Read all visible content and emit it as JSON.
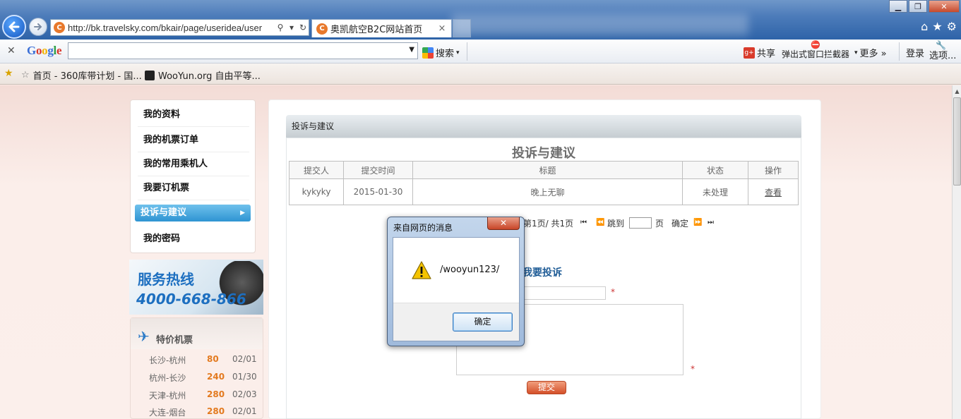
{
  "browser": {
    "address_url": "http://bk.travelsky.com/bkair/page/useridea/user",
    "active_tab_title": "奥凯航空B2C网站首页",
    "google_toolbar": {
      "logo": "Google",
      "search_label": "搜索",
      "share_label": "共享",
      "popup_blocker_label": "弹出式窗口拦截器",
      "more_label": "更多 »",
      "login_label": "登录",
      "options_label": "选项..."
    },
    "favorites": [
      {
        "label": "首页 - 360库带计划 - 国..."
      },
      {
        "label": "WooYun.org  自由平等..."
      }
    ]
  },
  "sidebar": {
    "items": [
      {
        "label": "我的资料"
      },
      {
        "label": "我的机票订单"
      },
      {
        "label": "我的常用乘机人"
      },
      {
        "label": "我要订机票"
      },
      {
        "label": "投诉与建议"
      },
      {
        "label": "我的密码"
      }
    ],
    "hotline": {
      "title": "服务热线",
      "number": "4000-668-866"
    },
    "specials": {
      "title": "特价机票",
      "rows": [
        {
          "route": "长沙-杭州",
          "price": "80",
          "date": "02/01"
        },
        {
          "route": "杭州-长沙",
          "price": "240",
          "date": "01/30"
        },
        {
          "route": "天津-杭州",
          "price": "280",
          "date": "02/03"
        },
        {
          "route": "大连-烟台",
          "price": "280",
          "date": "02/01"
        }
      ]
    }
  },
  "main": {
    "panel_header": "投诉与建议",
    "panel_title": "投诉与建议",
    "table": {
      "headers": [
        "提交人",
        "提交时间",
        "标题",
        "状态",
        "操作"
      ],
      "rows": [
        {
          "submitter": "kykyky",
          "time": "2015-01-30",
          "title": "晚上无聊",
          "status": "未处理",
          "action": "查看"
        }
      ]
    },
    "pager": {
      "page_info": "第1页/ 共1页",
      "jump_label": "跳到",
      "page_label": "页",
      "confirm_label": "确定"
    },
    "form": {
      "title": "我要投诉",
      "required_mark": "*",
      "submit_label": "提交"
    }
  },
  "dialog": {
    "title": "来自网页的消息",
    "message": "/wooyun123/",
    "ok_label": "确定"
  }
}
